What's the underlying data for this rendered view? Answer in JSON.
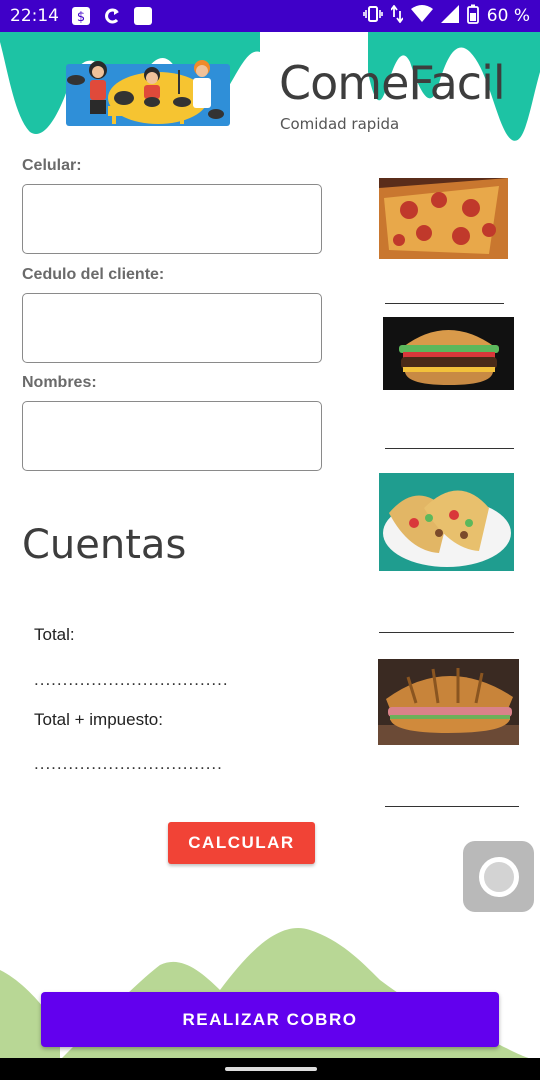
{
  "status_bar": {
    "time": "22:14",
    "battery": "60 %",
    "icons": [
      "sim-toolkit-icon",
      "sync-icon",
      "square-icon",
      "vibrate-icon",
      "data-arrows-icon",
      "wifi-icon",
      "signal-icon",
      "battery-icon"
    ]
  },
  "header": {
    "title": "ComeFacil",
    "subtitle": "Comidad rapida",
    "wave_color": "#1dc3a4"
  },
  "form": {
    "celular_label": "Celular:",
    "cedula_label": "Cedulo del cliente:",
    "nombres_label": "Nombres:",
    "celular_value": "",
    "cedula_value": "",
    "nombres_value": ""
  },
  "cuentas": {
    "title": "Cuentas",
    "total_label": "Total:",
    "total_value": "..................................",
    "total_tax_label": "Total + impuesto:",
    "total_tax_value": "................................."
  },
  "buttons": {
    "calcular": "CALCULAR",
    "realizar_cobro": "REALIZAR COBRO",
    "calcular_color": "#f14336",
    "cobro_color": "#6200ee"
  },
  "menu_images": [
    "pizza",
    "hamburger",
    "tacos",
    "croissant sandwich"
  ],
  "colors": {
    "status_bar": "#3f00c8",
    "hills": "#b8d795"
  }
}
